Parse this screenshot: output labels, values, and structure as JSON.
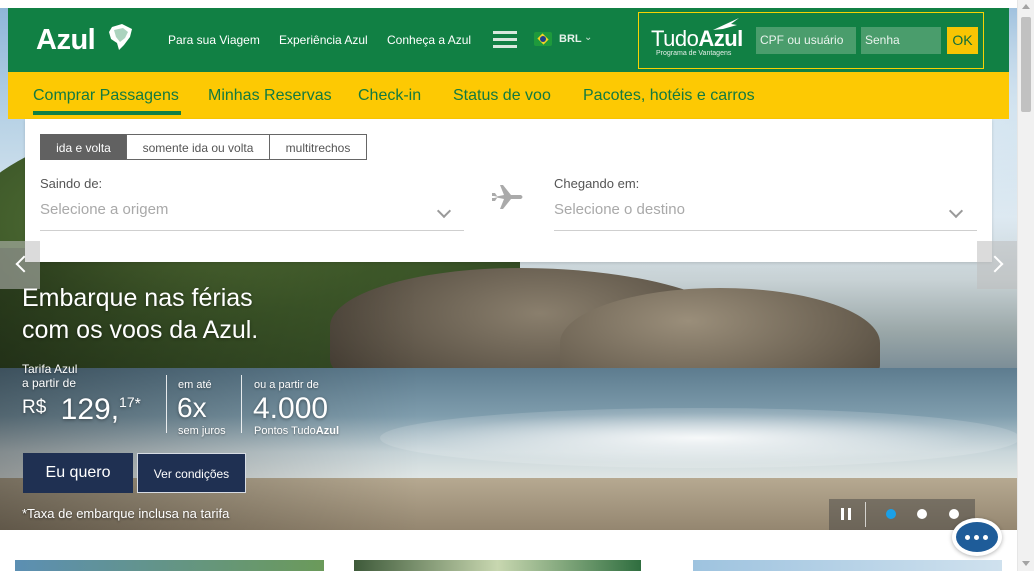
{
  "brand": {
    "logo_text": "Azul"
  },
  "topnav": {
    "items": [
      "Para sua Viagem",
      "Experiência Azul",
      "Conheça a Azul"
    ],
    "currency": "BRL"
  },
  "tudoazul": {
    "logo_light": "Tudo",
    "logo_bold": "Azul",
    "subtitle": "Programa de Vantagens",
    "user_placeholder": "CPF ou usuário",
    "password_placeholder": "Senha",
    "ok_label": "OK"
  },
  "yellownav": {
    "items": [
      "Comprar Passagens",
      "Minhas Reservas",
      "Check-in",
      "Status de voo",
      "Pacotes, hotéis e carros"
    ],
    "active_index": 0
  },
  "search": {
    "trip_types": [
      "ida e volta",
      "somente ida ou volta",
      "multitrechos"
    ],
    "selected_trip_type": "ida e volta",
    "from_label": "Saindo de:",
    "from_placeholder": "Selecione a origem",
    "to_label": "Chegando em:",
    "to_placeholder": "Selecione o destino"
  },
  "hero": {
    "title_line1": "Embarque nas férias",
    "title_line2": "com os voos da Azul.",
    "tariff_label1": "Tarifa Azul",
    "tariff_label2": "a partir de",
    "currency_symbol": "R$",
    "price_int": "129,",
    "price_cents": "17",
    "price_asterisk": "*",
    "installments_label": "em até",
    "installments_value": "6x",
    "installments_note": "sem juros",
    "points_label": "ou a partir de",
    "points_value": "4.000",
    "points_note_prefix": "Pontos Tudo",
    "points_note_bold": "Azul",
    "cta_primary": "Eu quero",
    "cta_secondary": "Ver condições",
    "tax_note": "*Taxa de embarque inclusa na tarifa"
  },
  "slider": {
    "slides": 3,
    "active": 0
  },
  "colors": {
    "green": "#118044",
    "yellow": "#fdc903",
    "navy": "#1f3052",
    "dot_active": "#1aa0e8"
  }
}
